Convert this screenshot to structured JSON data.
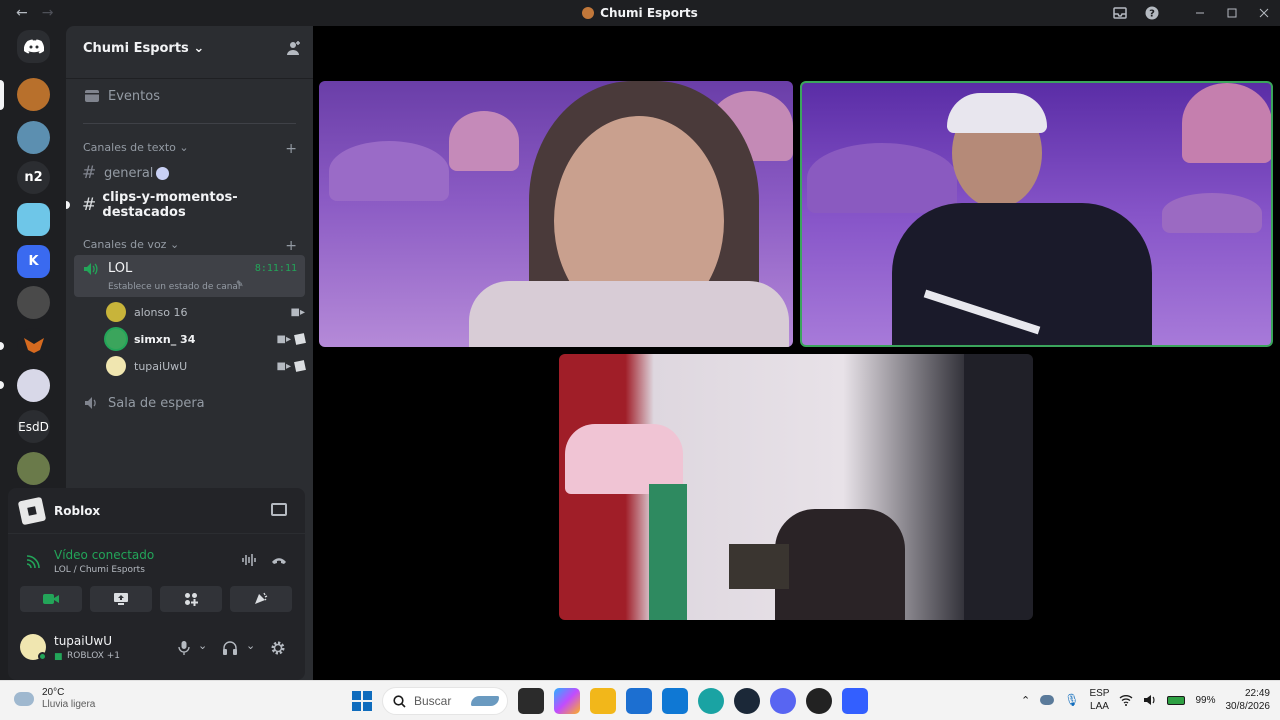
{
  "window": {
    "title": "Chumi Esports",
    "back": "←",
    "forward": "→"
  },
  "guilds": {
    "items": [
      {
        "label": "",
        "color": "#5865f2",
        "glyph": "◉"
      },
      {
        "label": "",
        "color": "#b8702c"
      },
      {
        "label": "",
        "color": "#5c8fb0"
      },
      {
        "label": "n2",
        "color": "#2b2d31"
      },
      {
        "label": "",
        "color": "#6ec6e8"
      },
      {
        "label": "K",
        "color": "#3a6af0"
      },
      {
        "label": "",
        "color": "#4a4a4a"
      },
      {
        "label": "",
        "color": "#1e1f22"
      },
      {
        "label": "",
        "color": "#d8d8e8"
      },
      {
        "label": "EsdD",
        "color": "#2b2d31"
      },
      {
        "label": "",
        "color": "#6a7a4a"
      }
    ]
  },
  "server": {
    "name": "Chumi Esports",
    "events_label": "Eventos",
    "text_category": "Canales de texto",
    "text_channels": [
      {
        "name": "general"
      },
      {
        "name": "clips-y-momentos-destacados"
      }
    ],
    "voice_category": "Canales de voz",
    "voice_channel": {
      "name": "LOL",
      "timer": "8:11:11",
      "status_hint": "Establece un estado de canal"
    },
    "voice_users": [
      {
        "name": "alonso 16",
        "color": "#c8b43a"
      },
      {
        "name": "simxn_ 34",
        "color": "#3ba55c"
      },
      {
        "name": "tupaiUwU",
        "color": "#f0e6b0"
      }
    ],
    "waiting_room": "Sala de espera"
  },
  "activity": {
    "name": "Roblox"
  },
  "voice_connection": {
    "status": "Vídeo conectado",
    "location": "LOL / Chumi Esports"
  },
  "user": {
    "name": "tupaiUwU",
    "status": "ROBLOX +1"
  },
  "taskbar": {
    "weather_temp": "20°C",
    "weather_desc": "Lluvia ligera",
    "search_placeholder": "Buscar",
    "lang_top": "ESP",
    "lang_bottom": "LAA",
    "battery": "99%",
    "time": "22:49",
    "date": "30/8/2026"
  },
  "colors": {
    "accent": "#5865f2",
    "green": "#3ba55c",
    "voice_text": "#23a559"
  }
}
